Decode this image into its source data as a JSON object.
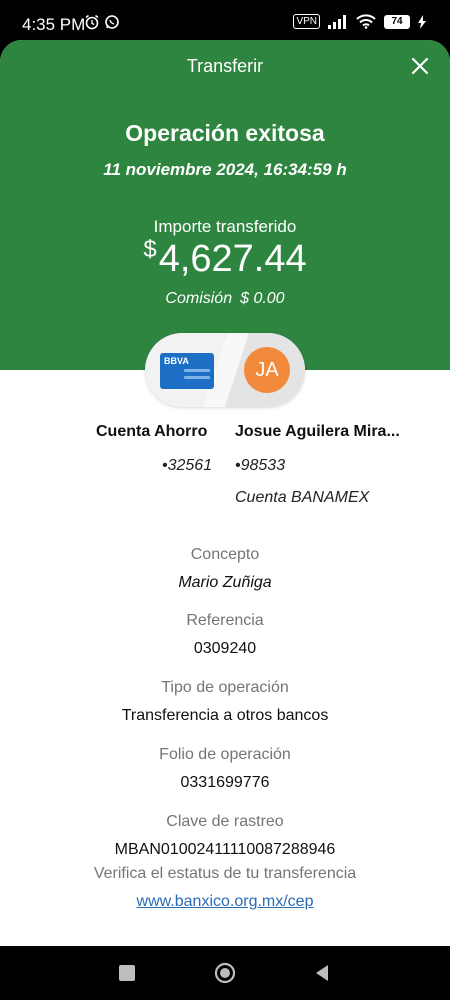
{
  "status_bar": {
    "time": "4:35 PM",
    "vpn": "VPN",
    "battery": "74"
  },
  "header": {
    "title": "Transferir",
    "success_title": "Operación exitosa",
    "datetime": "11 noviembre 2024, 16:34:59 h",
    "amount_label": "Importe transferido",
    "amount_symbol": "$",
    "amount_value": "4,627.44",
    "commission_label": "Comisión",
    "commission_value": "$ 0.00",
    "background_color": "#2e8540"
  },
  "transfer": {
    "card_brand": "BBVA",
    "avatar_initials": "JA",
    "from_account_name": "Cuenta Ahorro",
    "from_account_number": "•32561",
    "to_account_name": "Josue Aguilera Mira...",
    "to_account_number": "•98533",
    "to_account_bank": "Cuenta BANAMEX"
  },
  "details": [
    {
      "label": "Concepto",
      "value": "Mario Zuñiga"
    },
    {
      "label": "Referencia",
      "value": "0309240"
    },
    {
      "label": "Tipo de operación",
      "value": "Transferencia a otros bancos"
    },
    {
      "label": "Folio de operación",
      "value": "0331699776"
    },
    {
      "label": "Clave de rastreo",
      "value": "MBAN01002411110087288946"
    }
  ],
  "footer": {
    "verify_text": "Verifica el estatus de tu transferencia",
    "verify_link": "www.banxico.org.mx/cep"
  },
  "icons": {
    "close": "close-icon",
    "alarm": "alarm-icon",
    "whatsapp": "whatsapp-icon",
    "signal": "signal-icon",
    "wifi": "wifi-icon",
    "charging": "charging-icon",
    "nav_recent": "recent-apps-icon",
    "nav_home": "home-icon",
    "nav_back": "back-icon"
  }
}
